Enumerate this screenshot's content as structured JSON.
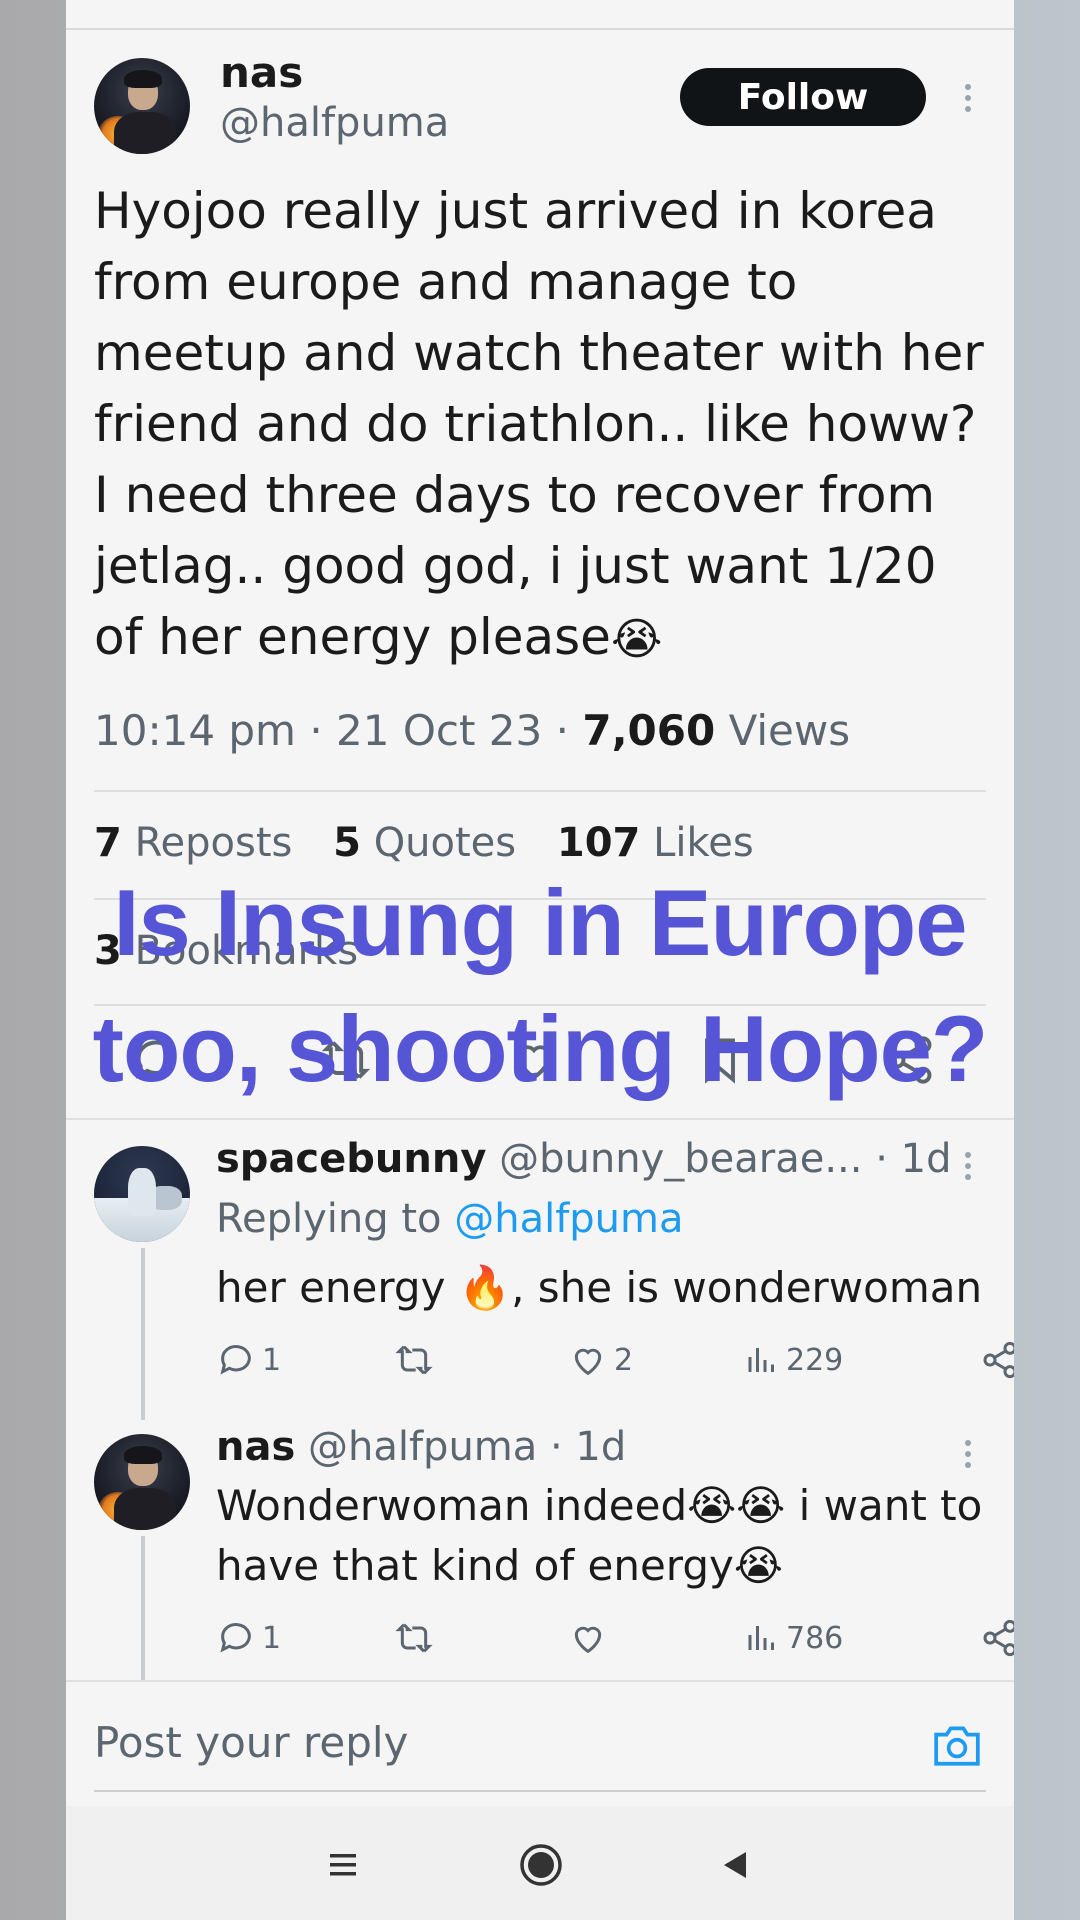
{
  "tweet": {
    "author_name": "nas",
    "author_handle": "@halfpuma",
    "follow_label": "Follow",
    "text": "Hyojoo really just arrived in korea from europe and manage to meetup and watch theater with her friend and do triathlon.. like howw? I need three days to recover from jetlag.. good god, i just want 1/20 of her energy please",
    "text_emoji": "😭",
    "time": "10:14 pm",
    "date": "21 Oct 23",
    "views_count": "7,060",
    "views_label": "Views",
    "separator": "·",
    "reposts_count": "7",
    "reposts_label": "Reposts",
    "quotes_count": "5",
    "quotes_label": "Quotes",
    "likes_count": "107",
    "likes_label": "Likes",
    "bookmarks_count": "3",
    "bookmarks_label": "Bookmarks"
  },
  "overlay_caption": {
    "line1": "Is Insung in Europe",
    "line2": "too, shooting Hope?"
  },
  "replies": [
    {
      "name": "spacebunny",
      "handle": "@bunny_bearae...",
      "time": "· 1d",
      "replying_prefix": "Replying to",
      "replying_mention": "@halfpuma",
      "text_before": "her energy",
      "emoji": "🔥",
      "text_after": ", she is wonderwoman",
      "reply_count": "1",
      "like_count": "2",
      "view_count": "229"
    },
    {
      "name": "nas",
      "handle": "@halfpuma",
      "time": "· 1d",
      "line1_text": "Wonderwoman indeed",
      "line1_emoji": "😭😭",
      "line1_after": " i want to",
      "line2_text": "have that kind of energy",
      "line2_emoji": "😭",
      "reply_count": "1",
      "view_count": "786"
    }
  ],
  "reply_box": {
    "placeholder": "Post your reply"
  },
  "colors": {
    "accent": "#1d9bf0",
    "caption": "#5655d6",
    "follow_button": "#111417"
  },
  "icons": {
    "reply": "reply-icon",
    "repost": "repost-icon",
    "like": "heart-icon",
    "bookmark": "bookmark-icon",
    "share": "share-icon",
    "views": "views-icon",
    "camera": "camera-icon",
    "nav_menu": "menu-icon",
    "nav_home": "home-icon",
    "nav_back": "back-icon"
  }
}
